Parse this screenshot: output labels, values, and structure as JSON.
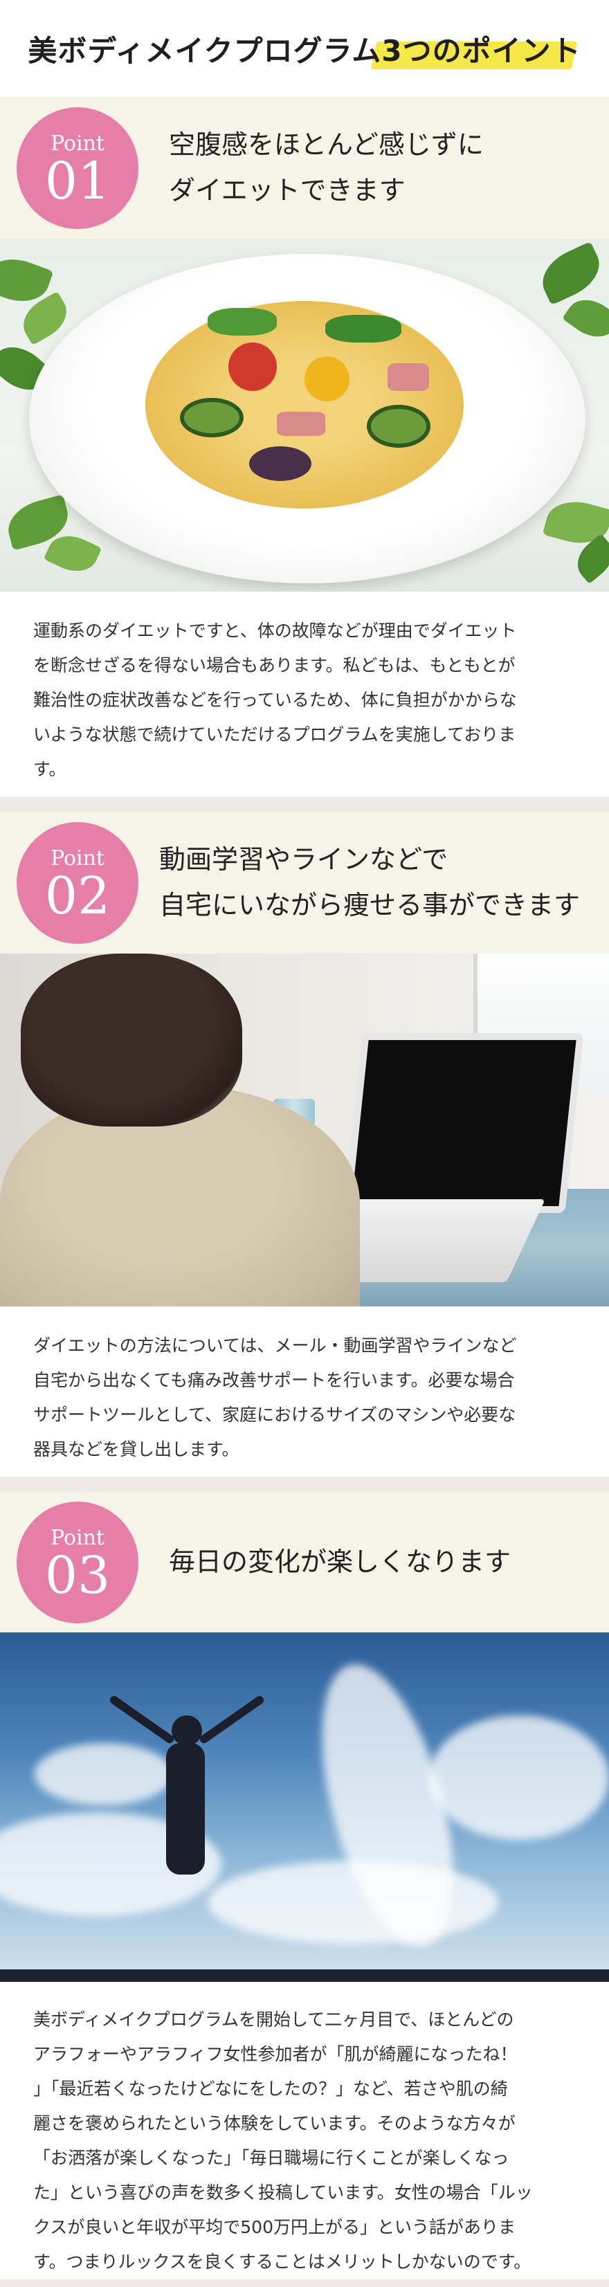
{
  "title": "美ボディメイクプログラム3つのポイント",
  "badge_label": "Point",
  "points": [
    {
      "number": "01",
      "heading_line1": "空腹感をほとんど感じずに",
      "heading_line2": "ダイエットできます",
      "lines": [
        "運動系のダイエットですと、体の故障などが理由でダイエット",
        "を断念せざるを得ない場合もあります。私どもは、もともとが",
        "難治性の症状改善などを行っているため、体に負担がかからな",
        "いような状態で続けていただけるプログラムを実施しておりま",
        "す。"
      ]
    },
    {
      "number": "02",
      "heading_line1": "動画学習やラインなどで",
      "heading_line2": "自宅にいながら痩せる事ができます",
      "lines": [
        "ダイエットの方法については、メール・動画学習やラインなど",
        "自宅から出なくても痛み改善サポートを行います。必要な場合",
        "サポートツールとして、家庭におけるサイズのマシンや必要な",
        "器具などを貸し出します。"
      ]
    },
    {
      "number": "03",
      "heading_line1": "毎日の変化が楽しくなります",
      "heading_line2": "",
      "lines": [
        "美ボディメイクプログラムを開始して二ヶ月目で、ほとんどの",
        "アラフォーやアラフィフ女性参加者が「肌が綺麗になったね！",
        "」「最近若くなったけどなにをしたの？」など、若さや肌の綺",
        "麗さを褒められたという体験をしています。そのような方々が",
        "「お洒落が楽しくなった」「毎日職場に行くことが楽しくなっ",
        "た」という喜びの声を数多く投稿しています。女性の場合「ルッ",
        "クスが良いと年収が平均で500万円上がる」という話がありま",
        "す。つまりルックスを良くすることはメリットしかないのです。"
      ]
    }
  ],
  "colors": {
    "badge": "#e57faa",
    "highlight": "#f7e84a",
    "header_bg": "#f6f3e7"
  }
}
